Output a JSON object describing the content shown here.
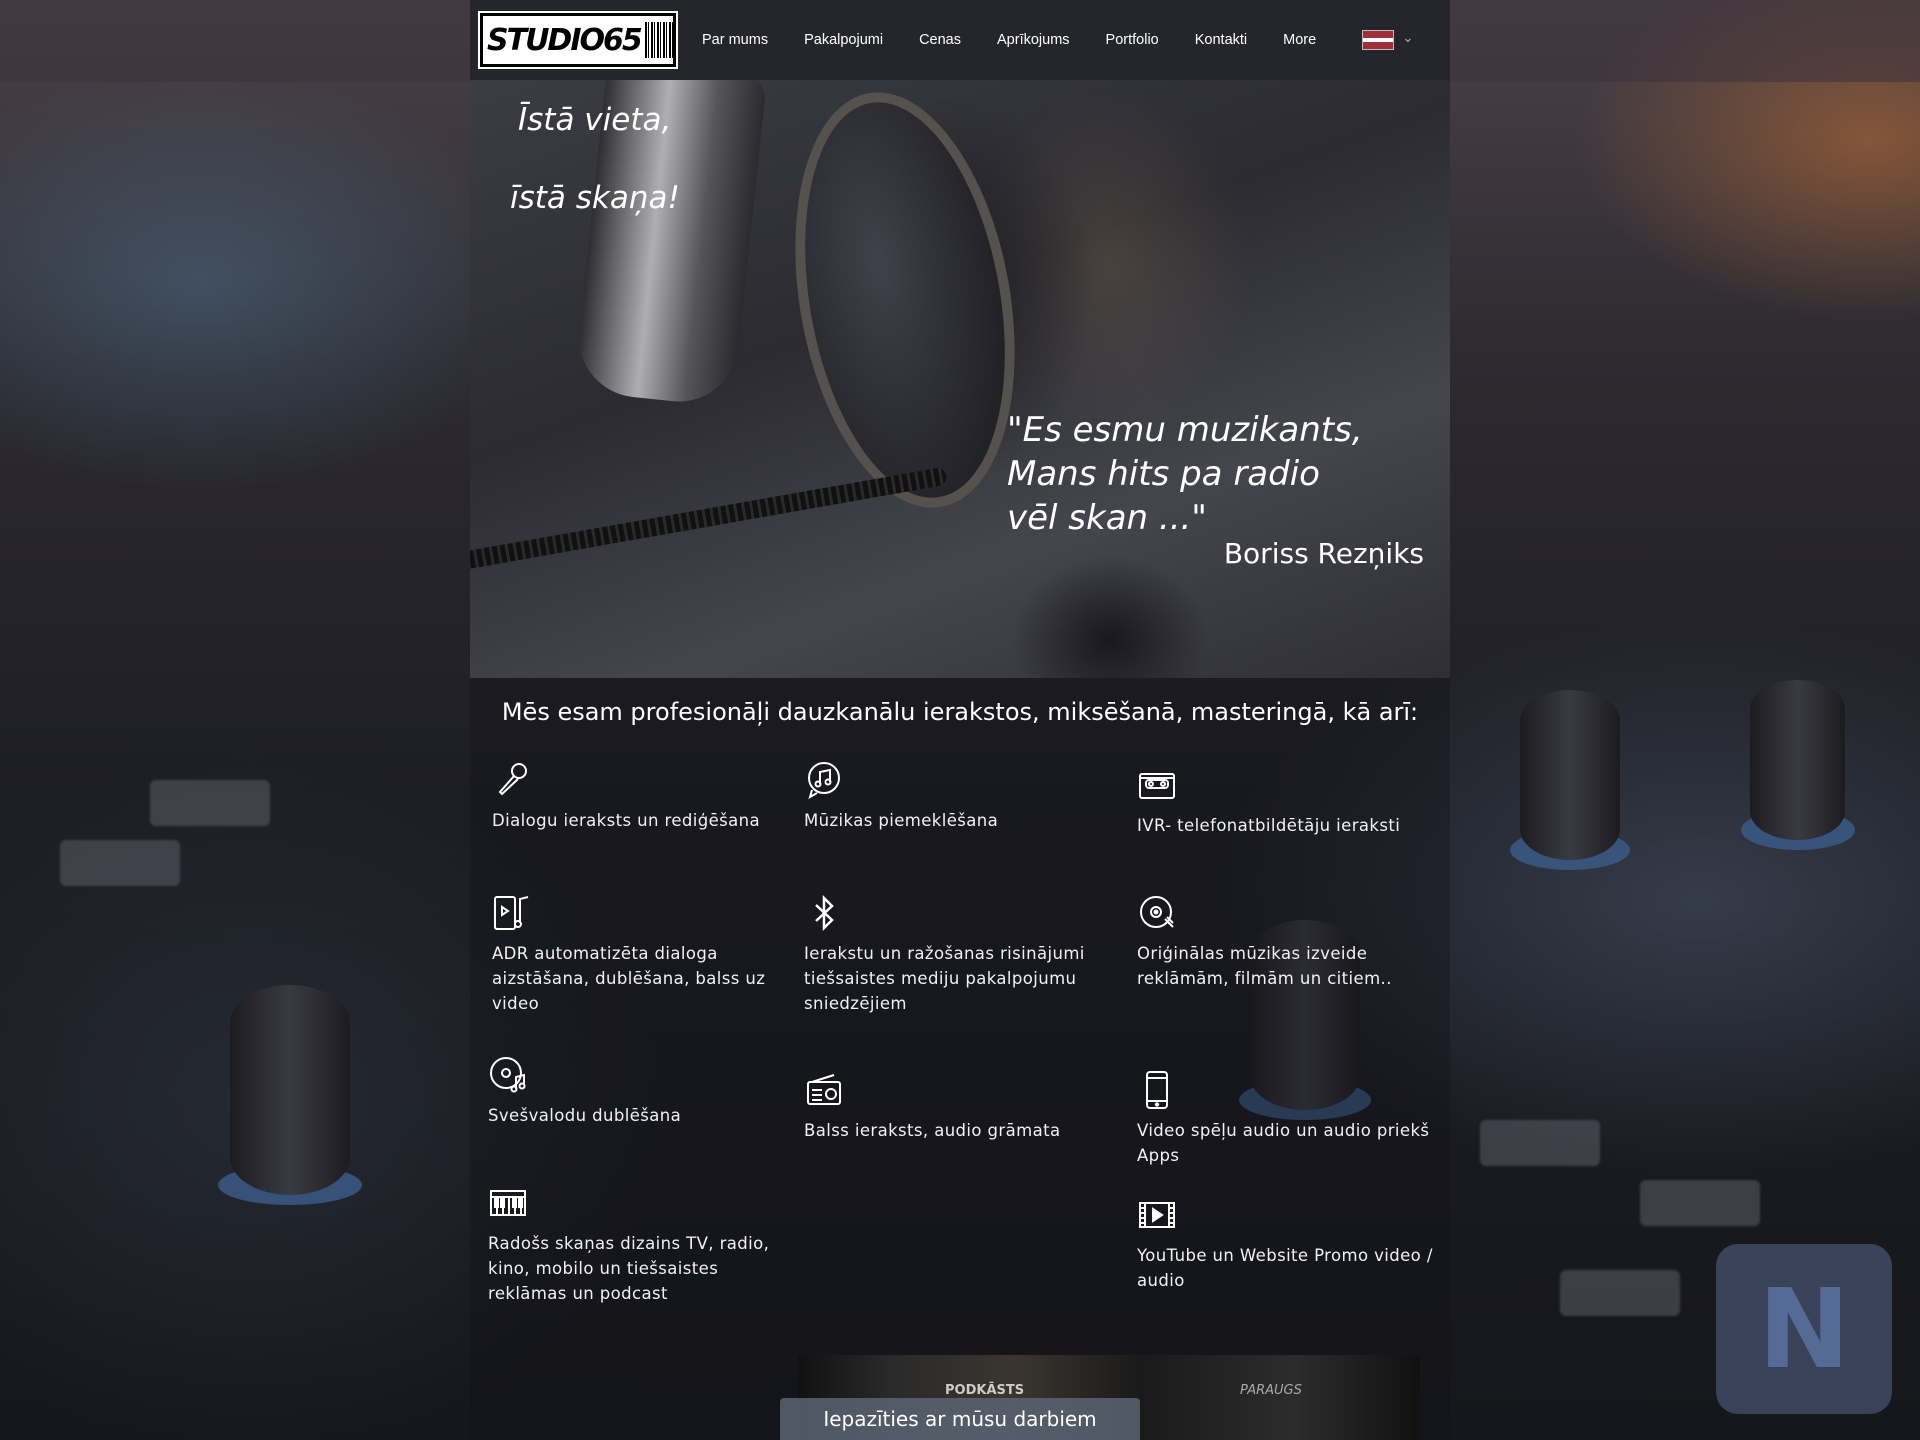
{
  "nav": {
    "logo_label": "STUDIO65",
    "items": [
      "Par mums",
      "Pakalpojumi",
      "Cenas",
      "Aprīkojums",
      "Portfolio",
      "Kontakti",
      "More"
    ],
    "language_flag": "latvia-flag-icon"
  },
  "hero": {
    "tagline_line1": "Īstā vieta,",
    "tagline_line2": "īstā skaņa!",
    "quote_line1": "\"Es esmu muzikants,",
    "quote_line2": "Mans hits pa radio",
    "quote_line3": "vēl skan ...\"",
    "quote_author": "Boriss Rezņiks"
  },
  "services": {
    "intro": "Mēs esam profesionāļi dauzkanālu ierakstos, miksēšanā, masteringā, kā arī:",
    "items": [
      {
        "label": "Dialogu ieraksts un rediģēšana",
        "icon": "microphone-icon"
      },
      {
        "label": "Mūzikas piemeklēšana",
        "icon": "music-note-icon"
      },
      {
        "label": "IVR- telefonatbildētāju ieraksti",
        "icon": "cassette-icon"
      },
      {
        "label": "ADR automatizēta dialoga aizstāšana, dublēšana, balss uz video",
        "icon": "phone-music-icon"
      },
      {
        "label": "Ierakstu un ražošanas risinājumi tiešsaistes mediju pakalpojumu sniedzējiem",
        "icon": "bluetooth-icon"
      },
      {
        "label": "Oriģinālas mūzikas izveide reklāmām, filmām un citiem..",
        "icon": "vinyl-icon"
      },
      {
        "label": "Svešvalodu dublēšana",
        "icon": "disc-music-icon"
      },
      {
        "label": "Balss ieraksts, audio grāmata",
        "icon": "radio-icon"
      },
      {
        "label": "Video spēļu audio un audio priekš Apps",
        "icon": "smartphone-icon"
      },
      {
        "label": "Radošs skaņas dizains TV, radio, kino, mobilo un tiešsaistes reklāmas un podcast",
        "icon": "piano-keys-icon"
      },
      {
        "label": "YouTube un Website Promo video / audio",
        "icon": "film-play-icon"
      }
    ]
  },
  "bottom": {
    "video_label_left": "PODKĀSTS",
    "video_label_right": "PARAUGS",
    "cta": "Iepazīties ar mūsu darbiem"
  },
  "colors": {
    "nav_bg": "#25262b",
    "cta_bg": "#5a6473",
    "flag_red": "#9e3039"
  }
}
